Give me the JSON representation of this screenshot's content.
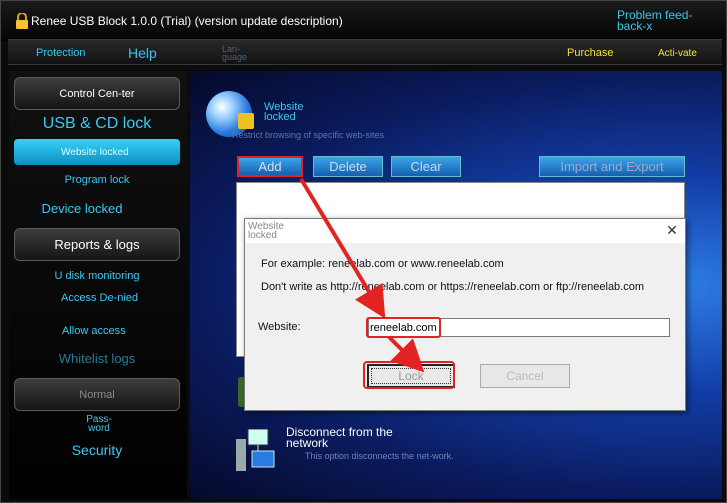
{
  "app": {
    "title": "Renee USB Block 1.0.0 (Trial) (version update description)",
    "feedback_label": "Problem feed-back-x"
  },
  "menu": {
    "protection": "Protection",
    "help": "Help",
    "language": "Lan-guage",
    "purchase": "Purchase",
    "activate": "Acti-vate"
  },
  "sidebar": {
    "control_center": "Control Cen-ter",
    "usb_cd_lock": "USB & CD lock",
    "website_locked": "Website locked",
    "program_lock": "Program lock",
    "device_locked": "Device locked",
    "reports_logs": "Reports & logs",
    "udisk_monitoring": "U disk monitoring",
    "access_denied": "Access De-nied",
    "allow_access": "Allow access",
    "whitelist_logs": "Whitelist logs",
    "normal": "Normal",
    "password": "Pass-word",
    "security": "Security"
  },
  "main": {
    "section_title": "Website locked",
    "section_desc": "Restrict browsing of specific web-sites",
    "add": "Add",
    "delete": "Delete",
    "clear": "Clear",
    "import_export": "Import and Export",
    "network_title": "Disconnect from the network",
    "network_desc": "This option disconnects the net-work."
  },
  "dialog": {
    "title": "Website locked",
    "example": "For example: reneelab.com or www.reneelab.com",
    "dont_write": "Don't write as http://reneelab.com or https://reneelab.com or ftp://reneelab.com",
    "website_label": "Website:",
    "website_value": "reneelab.com",
    "lock": "Lock",
    "cancel": "Cancel"
  },
  "colors": {
    "accent": "#3cc9f0",
    "highlight": "#e32222",
    "purchase": "#f2e233"
  }
}
